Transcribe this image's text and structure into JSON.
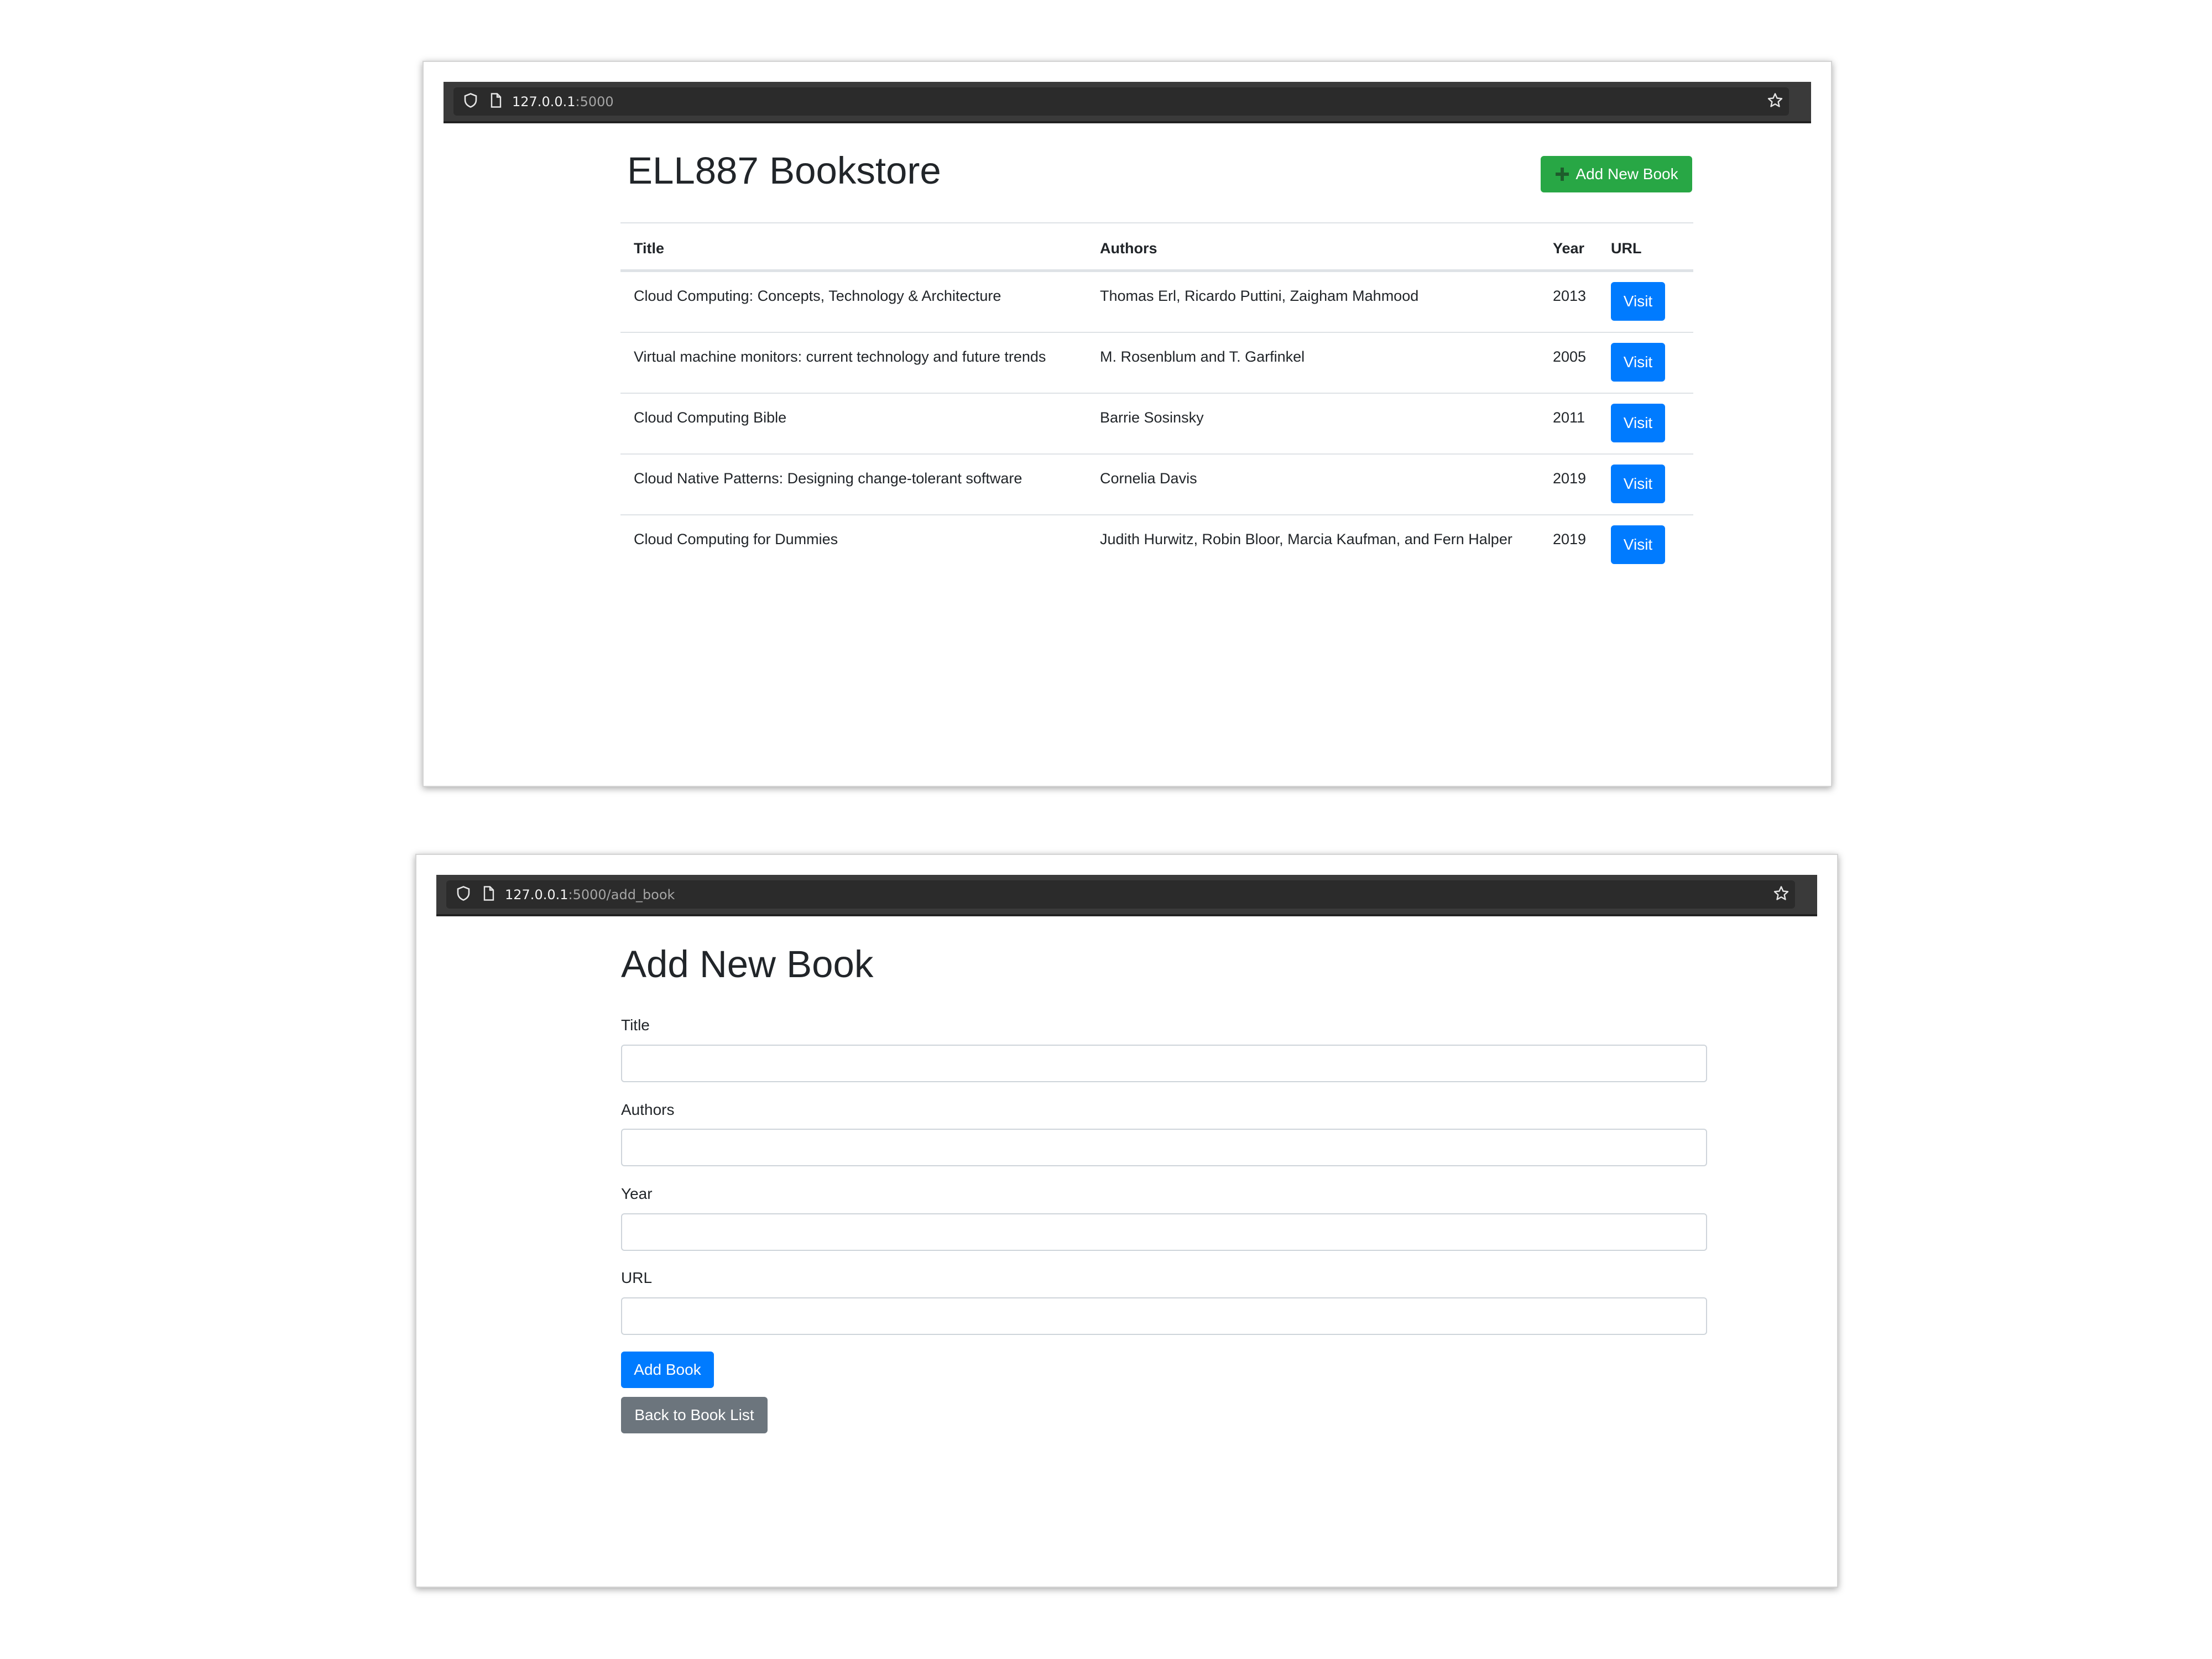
{
  "list_page": {
    "browser": {
      "url_host": "127.0.0.1",
      "url_path": ":5000",
      "icons": [
        "shield-icon",
        "page-icon",
        "star-icon"
      ]
    },
    "heading": "ELL887 Bookstore",
    "add_button": {
      "label": "Add New Book",
      "icon": "plus-icon"
    },
    "table": {
      "columns": [
        "Title",
        "Authors",
        "Year",
        "URL"
      ],
      "rows": [
        {
          "title": "Cloud Computing: Concepts, Technology & Architecture",
          "authors": "Thomas Erl, Ricardo Puttini, Zaigham Mahmood",
          "year": "2013",
          "link_label": "Visit"
        },
        {
          "title": "Virtual machine monitors: current technology and future trends",
          "authors": "M. Rosenblum and T. Garfinkel",
          "year": "2005",
          "link_label": "Visit"
        },
        {
          "title": "Cloud Computing Bible",
          "authors": "Barrie Sosinsky",
          "year": "2011",
          "link_label": "Visit"
        },
        {
          "title": "Cloud Native Patterns: Designing change-tolerant software",
          "authors": "Cornelia Davis",
          "year": "2019",
          "link_label": "Visit"
        },
        {
          "title": "Cloud Computing for Dummies",
          "authors": "Judith Hurwitz, Robin Bloor, Marcia Kaufman, and Fern Halper",
          "year": "2019",
          "link_label": "Visit"
        }
      ]
    }
  },
  "add_page": {
    "browser": {
      "url_host": "127.0.0.1",
      "url_path": ":5000/add_book",
      "icons": [
        "shield-icon",
        "page-icon",
        "star-icon"
      ]
    },
    "heading": "Add New Book",
    "fields": [
      {
        "label": "Title",
        "value": "",
        "placeholder": ""
      },
      {
        "label": "Authors",
        "value": "",
        "placeholder": ""
      },
      {
        "label": "Year",
        "value": "",
        "placeholder": ""
      },
      {
        "label": "URL",
        "value": "",
        "placeholder": ""
      }
    ],
    "submit_label": "Add Book",
    "back_label": "Back to Book List"
  },
  "colors": {
    "success": "#28a745",
    "primary": "#007bff",
    "secondary": "#6c757d",
    "urlbar": "#3a3a3a",
    "text": "#212529"
  }
}
